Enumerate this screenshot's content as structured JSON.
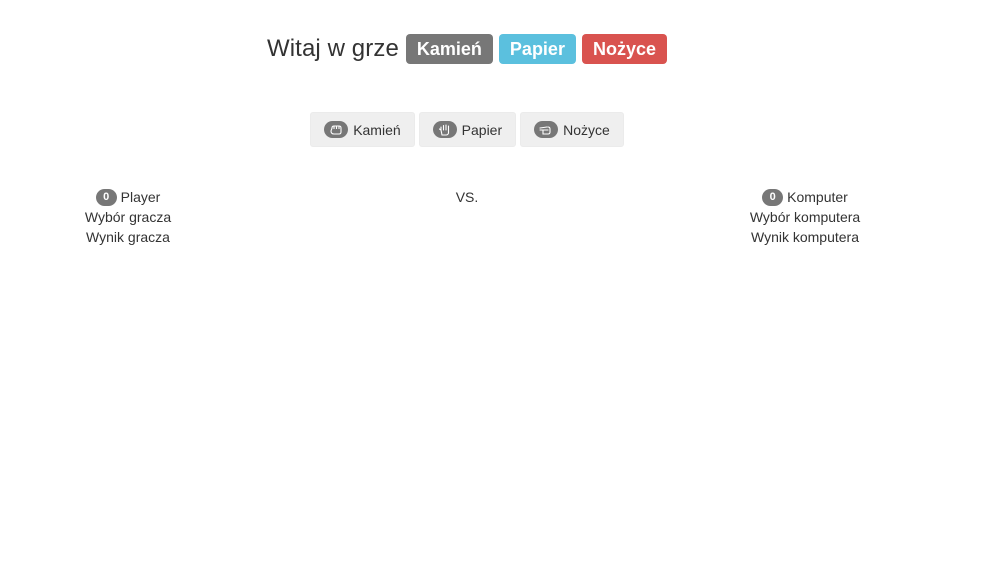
{
  "header": {
    "title": "Witaj w grze",
    "labels": {
      "kamien": "Kamień",
      "papier": "Papier",
      "nozyce": "Nożyce"
    },
    "colors": {
      "kamien": "#777777",
      "papier": "#5bc0de",
      "nozyce": "#d9534f"
    }
  },
  "choices": [
    {
      "label": "Kamień",
      "icon": "hand-rock-icon"
    },
    {
      "label": "Papier",
      "icon": "hand-paper-icon"
    },
    {
      "label": "Nożyce",
      "icon": "hand-scissors-icon"
    }
  ],
  "player": {
    "score": "0",
    "name": "Player",
    "choice": "Wybór gracza",
    "result": "Wynik gracza"
  },
  "vs": "VS.",
  "computer": {
    "score": "0",
    "name": "Komputer",
    "choice": "Wybór komputera",
    "result": "Wynik komputera"
  }
}
